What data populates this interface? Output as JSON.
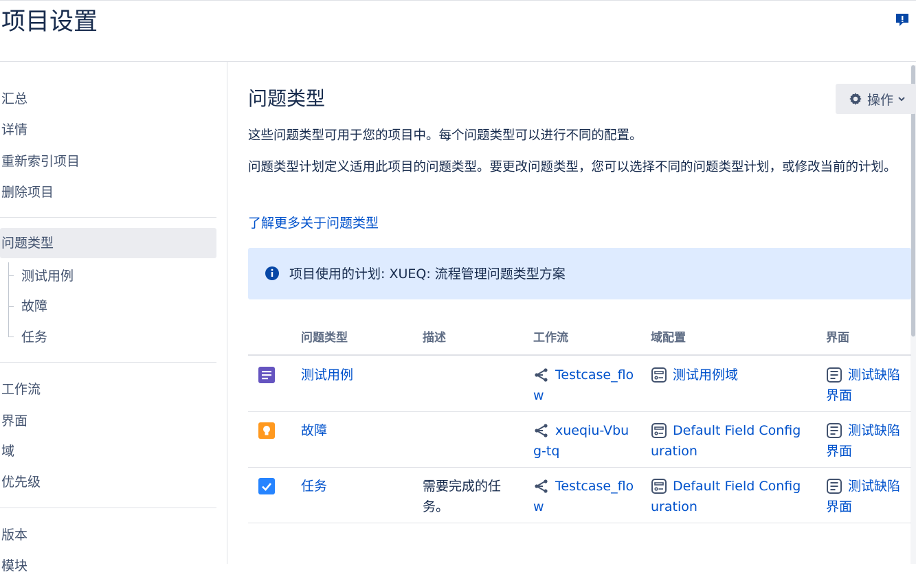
{
  "page": {
    "title": "项目设置"
  },
  "sidebar": {
    "items": [
      {
        "label": "汇总"
      },
      {
        "label": "详情"
      },
      {
        "label": "重新索引项目"
      },
      {
        "label": "删除项目"
      },
      {
        "label": "问题类型",
        "active": true
      },
      {
        "label": "工作流"
      },
      {
        "label": "界面"
      },
      {
        "label": "域"
      },
      {
        "label": "优先级"
      },
      {
        "label": "版本"
      },
      {
        "label": "模块"
      }
    ],
    "subitems": [
      {
        "label": "测试用例"
      },
      {
        "label": "故障"
      },
      {
        "label": "任务"
      }
    ]
  },
  "main": {
    "heading": "问题类型",
    "actions_label": "操作",
    "intro1": "这些问题类型可用于您的项目中。每个问题类型可以进行不同的配置。",
    "intro2": "问题类型计划定义适用此项目的问题类型。要更改问题类型，您可以选择不同的问题类型计划，或修改当前的计划。",
    "learn_more": "了解更多关于问题类型",
    "info": "项目使用的计划: XUEQ: 流程管理问题类型方案"
  },
  "table": {
    "headers": [
      "问题类型",
      "描述",
      "工作流",
      "域配置",
      "界面"
    ],
    "rows": [
      {
        "type": "测试用例",
        "type_icon": "story-icon",
        "description": "",
        "workflow_line1": "Testcase_flo",
        "workflow_line2": "w",
        "field_config_line1": "测试用例域",
        "field_config_line2": "",
        "screen_line1": "测试缺陷",
        "screen_line2": "界面"
      },
      {
        "type": "故障",
        "type_icon": "bug-lightbulb-icon",
        "description": "",
        "workflow_line1": "xueqiu-Vbu",
        "workflow_line2": "g-tq",
        "field_config_line1": "Default Field Config",
        "field_config_line2": "uration",
        "screen_line1": "测试缺陷",
        "screen_line2": "界面"
      },
      {
        "type": "任务",
        "type_icon": "task-checkbox-icon",
        "description_line1": "需要完成的任",
        "description_line2": "务。",
        "workflow_line1": "Testcase_flo",
        "workflow_line2": "w",
        "field_config_line1": "Default Field Config",
        "field_config_line2": "uration",
        "screen_line1": "测试缺陷",
        "screen_line2": "界面"
      }
    ]
  },
  "colors": {
    "link": "#0052cc",
    "info_panel": "#deebff",
    "story_icon": "#6554c0",
    "bug_icon": "#ff991f",
    "task_icon": "#2684ff"
  }
}
